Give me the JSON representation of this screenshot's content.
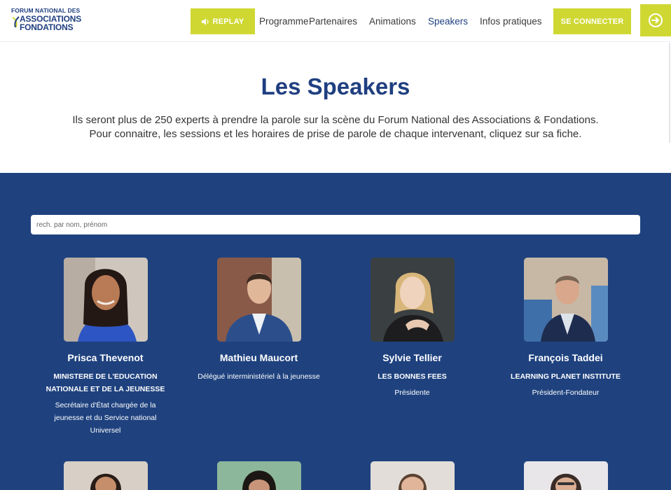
{
  "header": {
    "logo": {
      "line1": "FORUM NATIONAL DES",
      "line2": "ASSOCIATIONS",
      "line3": "FONDATIONS"
    },
    "replay_label": "REPLAY",
    "nav": [
      {
        "label": "Programme",
        "active": false
      },
      {
        "label": "Partenaires",
        "active": false
      },
      {
        "label": "Animations",
        "active": false
      },
      {
        "label": "Speakers",
        "active": true
      },
      {
        "label": "Infos pratiques",
        "active": false
      }
    ],
    "connect_label": "SE CONNECTER",
    "login_icon": "login-arrow-icon"
  },
  "intro": {
    "title": "Les Speakers",
    "line1": "Ils seront plus de 250 experts à prendre la parole sur la scène du Forum National des Associations & Fondations.",
    "line2": "Pour connaitre, les sessions et les horaires de prise de parole de chaque intervenant, cliquez sur sa fiche."
  },
  "search": {
    "placeholder": "rech. par nom, prénom",
    "value": ""
  },
  "speakers": [
    {
      "name": "Prisca Thevenot",
      "org_lines": [
        "MINISTERE DE L'EDUCATION",
        "NATIONALE ET DE LA JEUNESSE"
      ],
      "role_lines": [
        "Secrétaire d'État chargée de la",
        "jeunesse et du Service national",
        "Universel"
      ]
    },
    {
      "name": "Mathieu Maucort",
      "org_lines": [],
      "role_lines": [
        "Délégué interministériel à la jeunesse"
      ]
    },
    {
      "name": "Sylvie Tellier",
      "org_lines": [
        "LES BONNES FEES"
      ],
      "role_lines": [
        "Présidente"
      ]
    },
    {
      "name": "François Taddei",
      "org_lines": [
        "LEARNING PLANET INSTITUTE"
      ],
      "role_lines": [
        "Président-Fondateur"
      ]
    }
  ],
  "colors": {
    "navy": "#1f427f",
    "lime": "#cfd833",
    "title": "#1f3f80"
  }
}
